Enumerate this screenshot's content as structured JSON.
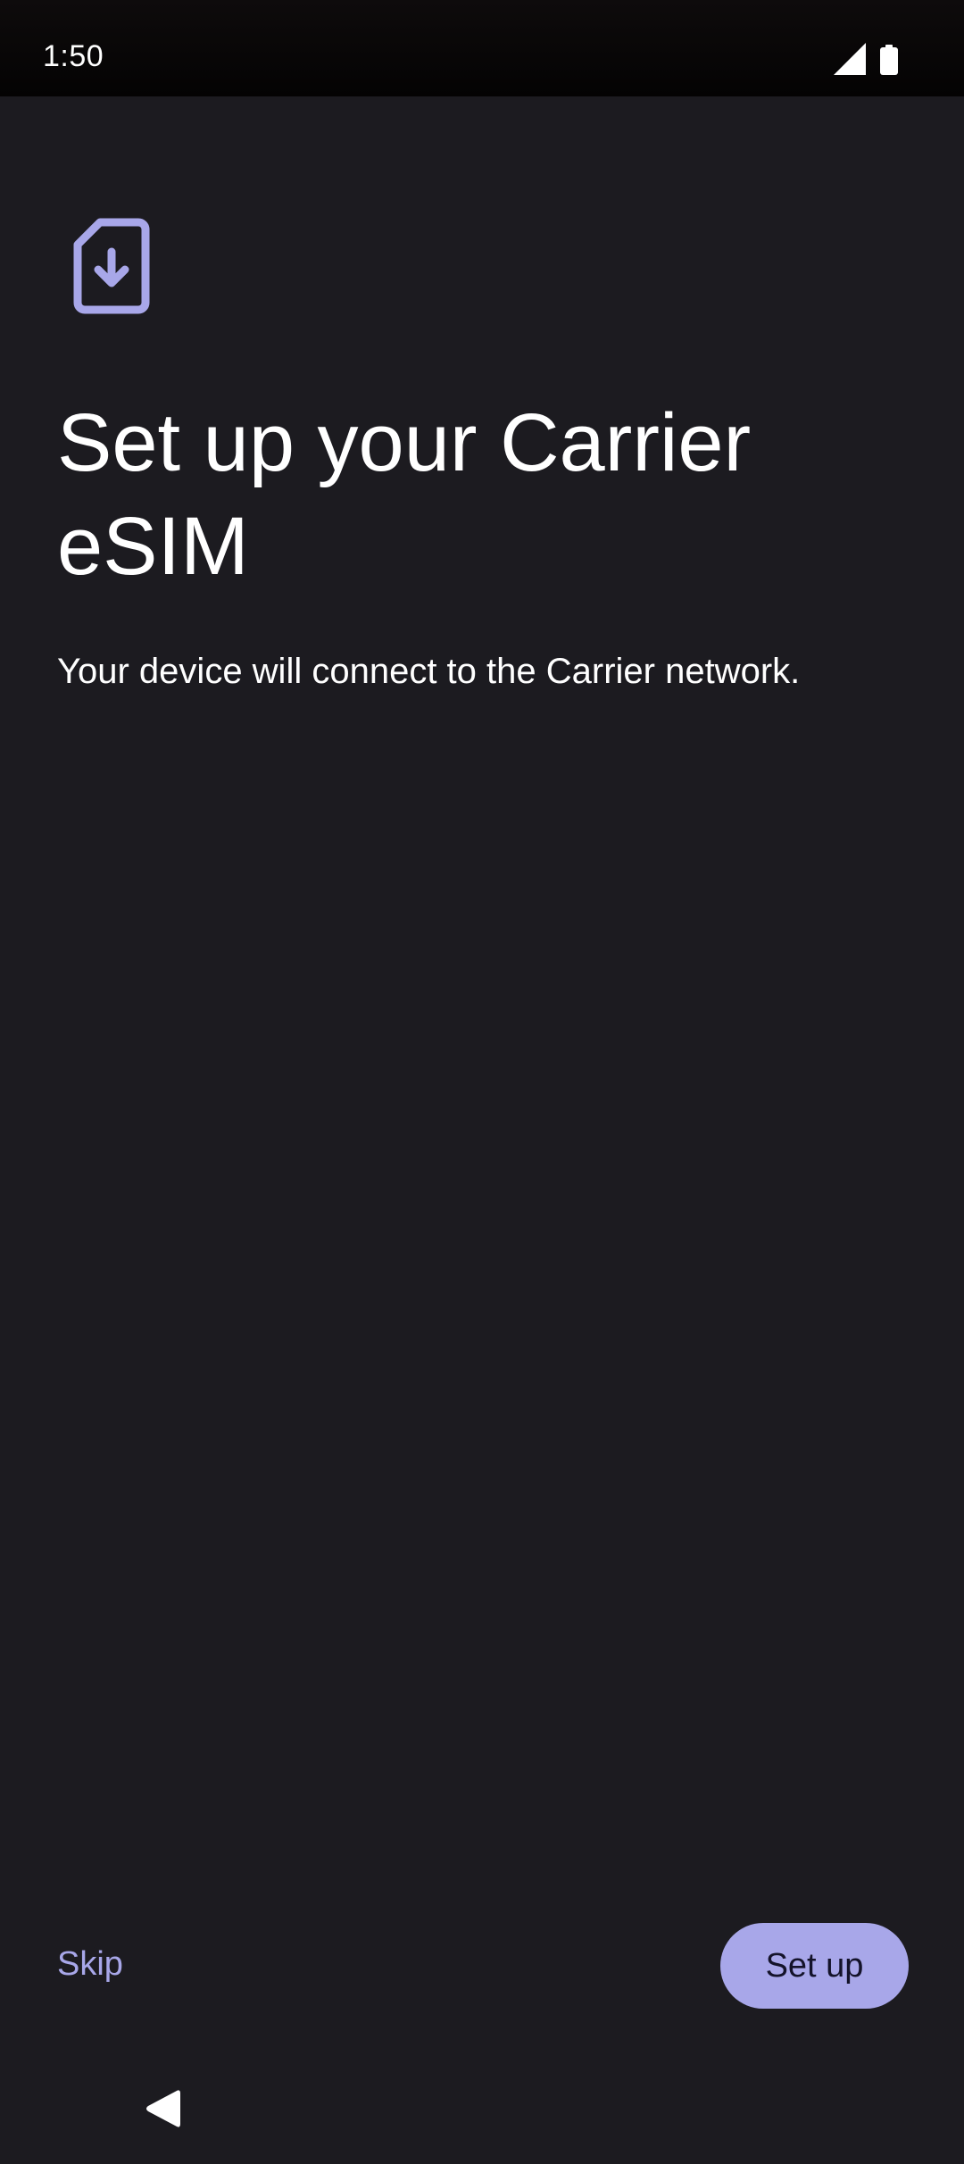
{
  "status_bar": {
    "time": "1:50",
    "signal_icon": "cellular-signal-icon",
    "battery_icon": "battery-icon"
  },
  "header": {
    "icon": "esim-download-icon",
    "title": "Set up your Carrier eSIM",
    "subtitle": "Your device will connect to the Carrier network."
  },
  "actions": {
    "skip_label": "Skip",
    "setup_label": "Set up"
  },
  "nav_bar": {
    "back_icon": "back-triangle-icon"
  },
  "colors": {
    "background": "#1c1b20",
    "accent": "#a8a7e9",
    "on_accent": "#14132a",
    "text": "#ffffff"
  }
}
